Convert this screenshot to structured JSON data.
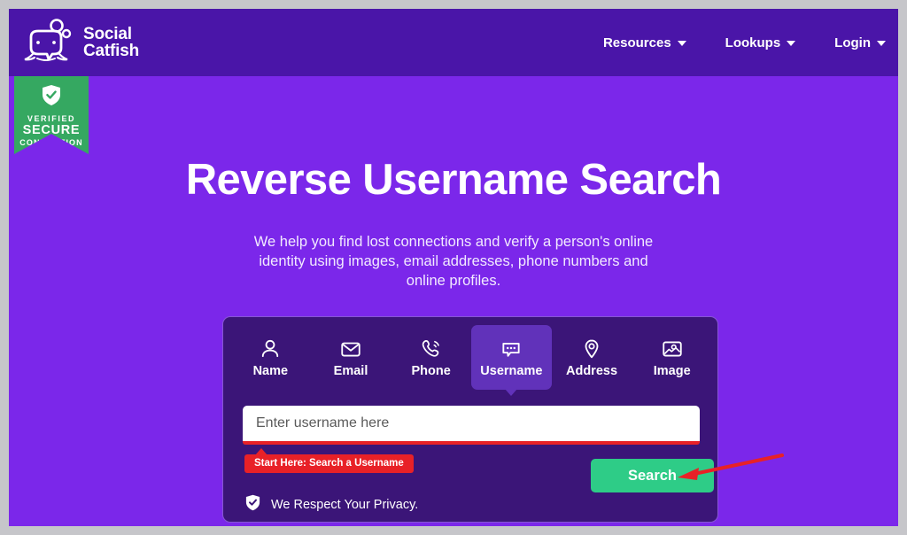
{
  "brand": {
    "name_line1": "Social",
    "name_line2": "Catfish",
    "logo_icon": "catfish-logo-icon",
    "header_bg": "#4a15a8",
    "page_bg": "#7b27ea"
  },
  "nav": {
    "items": [
      {
        "label": "Resources",
        "icon": "chevron-down-icon"
      },
      {
        "label": "Lookups",
        "icon": "chevron-down-icon"
      },
      {
        "label": "Login",
        "icon": "chevron-down-icon"
      }
    ]
  },
  "secure_badge": {
    "icon": "shield-check-icon",
    "line1": "VERIFIED",
    "line2": "SECURE",
    "line3": "CONNECTION",
    "color": "#35a861"
  },
  "hero": {
    "title": "Reverse Username Search",
    "subtitle": "We help you find lost connections and verify a person's online identity using images, email addresses, phone numbers and online profiles."
  },
  "search": {
    "tabs": [
      {
        "label": "Name",
        "icon": "person-icon",
        "active": false
      },
      {
        "label": "Email",
        "icon": "envelope-icon",
        "active": false
      },
      {
        "label": "Phone",
        "icon": "phone-icon",
        "active": false
      },
      {
        "label": "Username",
        "icon": "speech-bubble-icon",
        "active": true
      },
      {
        "label": "Address",
        "icon": "map-pin-icon",
        "active": false
      },
      {
        "label": "Image",
        "icon": "photo-icon",
        "active": false
      }
    ],
    "input_placeholder": "Enter username here",
    "input_value": "",
    "button_label": "Search",
    "button_color": "#2ecc87",
    "privacy_label": "We Respect Your Privacy.",
    "privacy_icon": "shield-check-icon",
    "card_bg": "#3b1578",
    "active_tab_bg": "#6132ba"
  },
  "annotations": {
    "callout_label": "Start Here: Search a Username",
    "callout_color": "#e82127",
    "arrow_icon": "arrow-left-icon",
    "arrow_color": "#e82127"
  }
}
